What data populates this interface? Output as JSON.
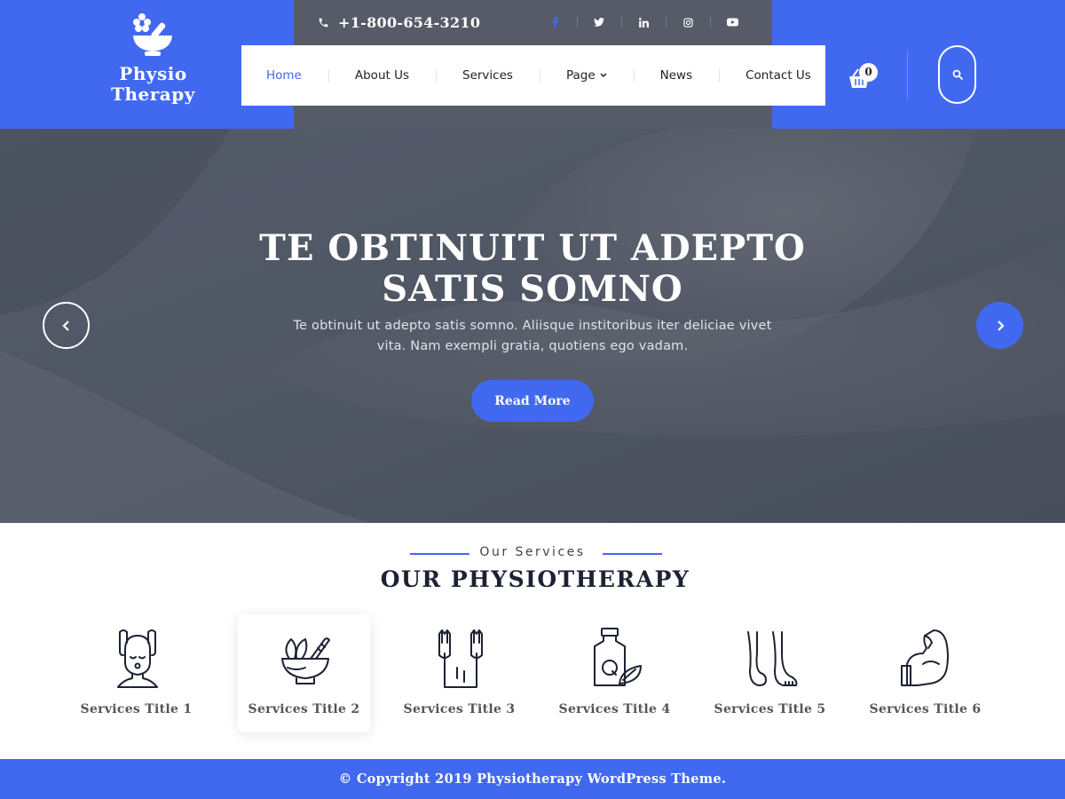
{
  "brand": {
    "line1": "Physio",
    "line2": "Therapy",
    "logo_icon": "mortar-pestle-flower-icon"
  },
  "topbar": {
    "phone": "+1-800-654-3210",
    "phone_icon": "phone-icon",
    "social": [
      "facebook-icon",
      "twitter-icon",
      "linkedin-icon",
      "instagram-icon",
      "youtube-icon"
    ]
  },
  "nav": {
    "items": [
      {
        "label": "Home",
        "active": true
      },
      {
        "label": "About Us"
      },
      {
        "label": "Services"
      },
      {
        "label": "Page",
        "has_dropdown": true
      },
      {
        "label": "News"
      },
      {
        "label": "Contact Us"
      }
    ]
  },
  "cart": {
    "count": "0",
    "icon": "shopping-basket-icon"
  },
  "search": {
    "icon": "search-icon"
  },
  "hero": {
    "title_line1": "TE OBTINUIT UT ADEPTO",
    "title_line2": "SATIS SOMNO",
    "desc_line1": "Te obtinuit ut adepto satis somno. Aliisque institoribus iter deliciae vivet",
    "desc_line2": "vita. Nam exempli gratia, quotiens ego vadam.",
    "button": "Read More",
    "prev_icon": "chevron-left-icon",
    "next_icon": "chevron-right-icon"
  },
  "services": {
    "subtitle": "Our Services",
    "title": "OUR PHYSIOTHERAPY",
    "items": [
      {
        "title": "Services Title 1",
        "icon": "face-massage-icon"
      },
      {
        "title": "Services Title 2",
        "icon": "mortar-herbs-icon"
      },
      {
        "title": "Services Title 3",
        "icon": "back-massage-hands-icon"
      },
      {
        "title": "Services Title 4",
        "icon": "oil-bottle-leaf-icon"
      },
      {
        "title": "Services Title 5",
        "icon": "feet-icon"
      },
      {
        "title": "Services Title 6",
        "icon": "flexed-arm-icon"
      }
    ]
  },
  "footer": {
    "copyright": "© Copyright 2019 Physiotherapy WordPress Theme."
  },
  "colors": {
    "accent": "#4169f0",
    "topbar": "#565b67",
    "hero_overlay": "#4b505d",
    "text_dark": "#1d2233"
  }
}
